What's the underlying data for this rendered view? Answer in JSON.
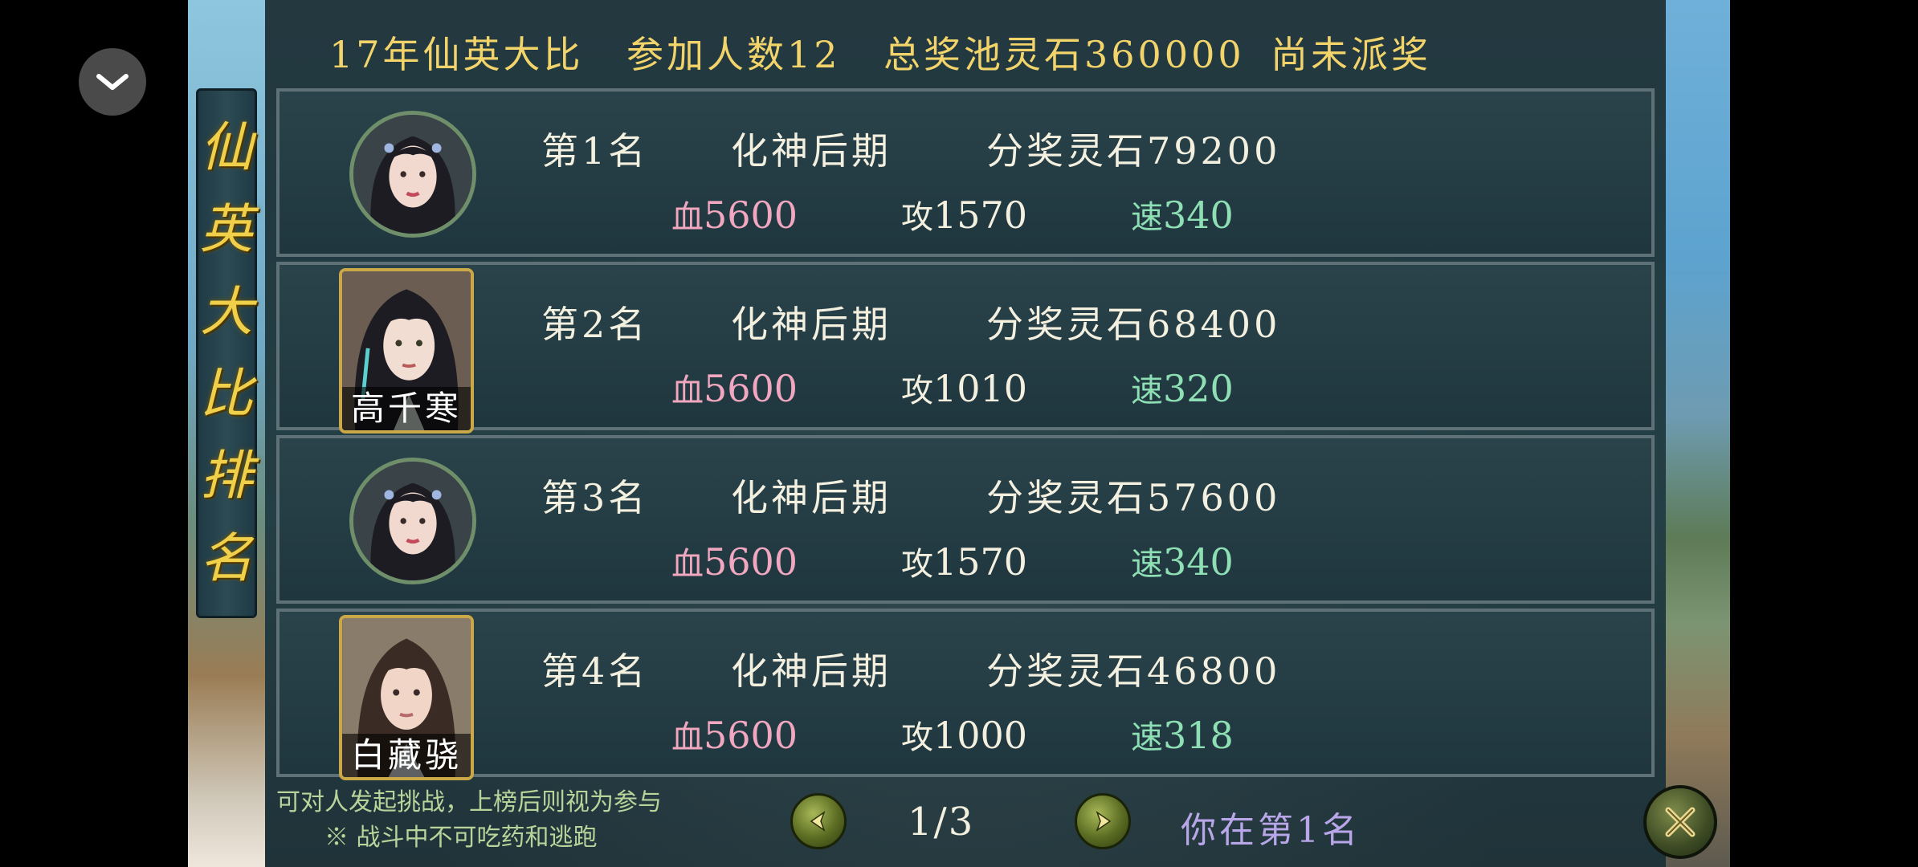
{
  "header": {
    "title": "17年仙英大比",
    "participants": "参加人数12",
    "prize_pool": "总奖池灵石360000",
    "status": "尚未派奖"
  },
  "side_title": [
    "仙",
    "英",
    "大",
    "比",
    "排",
    "名"
  ],
  "stat_labels": {
    "hp": "血",
    "atk": "攻",
    "spd": "速"
  },
  "ranking": [
    {
      "rank": "第1名",
      "realm": "化神后期",
      "reward": "分奖灵石79200",
      "hp": "5600",
      "atk": "1570",
      "spd": "340",
      "avatar": "round",
      "name": ""
    },
    {
      "rank": "第2名",
      "realm": "化神后期",
      "reward": "分奖灵石68400",
      "hp": "5600",
      "atk": "1010",
      "spd": "320",
      "avatar": "square",
      "name": "高千寒"
    },
    {
      "rank": "第3名",
      "realm": "化神后期",
      "reward": "分奖灵石57600",
      "hp": "5600",
      "atk": "1570",
      "spd": "340",
      "avatar": "round",
      "name": ""
    },
    {
      "rank": "第4名",
      "realm": "化神后期",
      "reward": "分奖灵石46800",
      "hp": "5600",
      "atk": "1000",
      "spd": "318",
      "avatar": "square",
      "name": "白藏骁"
    }
  ],
  "footer": {
    "notice_line1": "可对人发起挑战，上榜后则视为参与",
    "notice_line2": "※ 战斗中不可吃药和逃跑",
    "page": "1/3",
    "my_rank": "你在第1名"
  },
  "icons": {
    "collapse": "chevron-down-icon",
    "prev": "arrow-left-icon",
    "next": "arrow-right-icon",
    "close": "close-x-icon"
  },
  "colors": {
    "header_gold": "#f2d46a",
    "hp": "#f1a7bf",
    "speed": "#8ee0b4",
    "my_rank": "#b9a6e8"
  }
}
